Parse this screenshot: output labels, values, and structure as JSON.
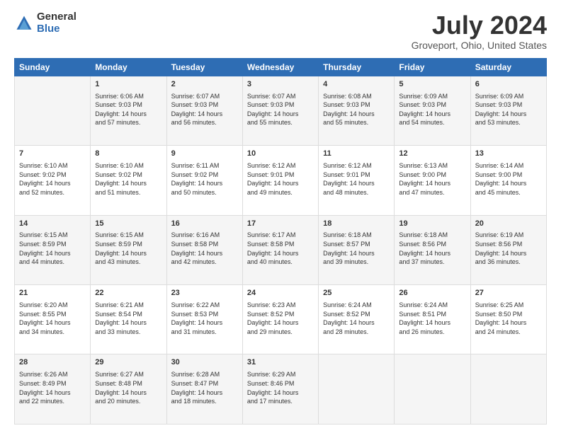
{
  "header": {
    "logo_general": "General",
    "logo_blue": "Blue",
    "title": "July 2024",
    "subtitle": "Groveport, Ohio, United States"
  },
  "days_of_week": [
    "Sunday",
    "Monday",
    "Tuesday",
    "Wednesday",
    "Thursday",
    "Friday",
    "Saturday"
  ],
  "weeks": [
    [
      {
        "day": "",
        "content": ""
      },
      {
        "day": "1",
        "content": "Sunrise: 6:06 AM\nSunset: 9:03 PM\nDaylight: 14 hours\nand 57 minutes."
      },
      {
        "day": "2",
        "content": "Sunrise: 6:07 AM\nSunset: 9:03 PM\nDaylight: 14 hours\nand 56 minutes."
      },
      {
        "day": "3",
        "content": "Sunrise: 6:07 AM\nSunset: 9:03 PM\nDaylight: 14 hours\nand 55 minutes."
      },
      {
        "day": "4",
        "content": "Sunrise: 6:08 AM\nSunset: 9:03 PM\nDaylight: 14 hours\nand 55 minutes."
      },
      {
        "day": "5",
        "content": "Sunrise: 6:09 AM\nSunset: 9:03 PM\nDaylight: 14 hours\nand 54 minutes."
      },
      {
        "day": "6",
        "content": "Sunrise: 6:09 AM\nSunset: 9:03 PM\nDaylight: 14 hours\nand 53 minutes."
      }
    ],
    [
      {
        "day": "7",
        "content": "Sunrise: 6:10 AM\nSunset: 9:02 PM\nDaylight: 14 hours\nand 52 minutes."
      },
      {
        "day": "8",
        "content": "Sunrise: 6:10 AM\nSunset: 9:02 PM\nDaylight: 14 hours\nand 51 minutes."
      },
      {
        "day": "9",
        "content": "Sunrise: 6:11 AM\nSunset: 9:02 PM\nDaylight: 14 hours\nand 50 minutes."
      },
      {
        "day": "10",
        "content": "Sunrise: 6:12 AM\nSunset: 9:01 PM\nDaylight: 14 hours\nand 49 minutes."
      },
      {
        "day": "11",
        "content": "Sunrise: 6:12 AM\nSunset: 9:01 PM\nDaylight: 14 hours\nand 48 minutes."
      },
      {
        "day": "12",
        "content": "Sunrise: 6:13 AM\nSunset: 9:00 PM\nDaylight: 14 hours\nand 47 minutes."
      },
      {
        "day": "13",
        "content": "Sunrise: 6:14 AM\nSunset: 9:00 PM\nDaylight: 14 hours\nand 45 minutes."
      }
    ],
    [
      {
        "day": "14",
        "content": "Sunrise: 6:15 AM\nSunset: 8:59 PM\nDaylight: 14 hours\nand 44 minutes."
      },
      {
        "day": "15",
        "content": "Sunrise: 6:15 AM\nSunset: 8:59 PM\nDaylight: 14 hours\nand 43 minutes."
      },
      {
        "day": "16",
        "content": "Sunrise: 6:16 AM\nSunset: 8:58 PM\nDaylight: 14 hours\nand 42 minutes."
      },
      {
        "day": "17",
        "content": "Sunrise: 6:17 AM\nSunset: 8:58 PM\nDaylight: 14 hours\nand 40 minutes."
      },
      {
        "day": "18",
        "content": "Sunrise: 6:18 AM\nSunset: 8:57 PM\nDaylight: 14 hours\nand 39 minutes."
      },
      {
        "day": "19",
        "content": "Sunrise: 6:18 AM\nSunset: 8:56 PM\nDaylight: 14 hours\nand 37 minutes."
      },
      {
        "day": "20",
        "content": "Sunrise: 6:19 AM\nSunset: 8:56 PM\nDaylight: 14 hours\nand 36 minutes."
      }
    ],
    [
      {
        "day": "21",
        "content": "Sunrise: 6:20 AM\nSunset: 8:55 PM\nDaylight: 14 hours\nand 34 minutes."
      },
      {
        "day": "22",
        "content": "Sunrise: 6:21 AM\nSunset: 8:54 PM\nDaylight: 14 hours\nand 33 minutes."
      },
      {
        "day": "23",
        "content": "Sunrise: 6:22 AM\nSunset: 8:53 PM\nDaylight: 14 hours\nand 31 minutes."
      },
      {
        "day": "24",
        "content": "Sunrise: 6:23 AM\nSunset: 8:52 PM\nDaylight: 14 hours\nand 29 minutes."
      },
      {
        "day": "25",
        "content": "Sunrise: 6:24 AM\nSunset: 8:52 PM\nDaylight: 14 hours\nand 28 minutes."
      },
      {
        "day": "26",
        "content": "Sunrise: 6:24 AM\nSunset: 8:51 PM\nDaylight: 14 hours\nand 26 minutes."
      },
      {
        "day": "27",
        "content": "Sunrise: 6:25 AM\nSunset: 8:50 PM\nDaylight: 14 hours\nand 24 minutes."
      }
    ],
    [
      {
        "day": "28",
        "content": "Sunrise: 6:26 AM\nSunset: 8:49 PM\nDaylight: 14 hours\nand 22 minutes."
      },
      {
        "day": "29",
        "content": "Sunrise: 6:27 AM\nSunset: 8:48 PM\nDaylight: 14 hours\nand 20 minutes."
      },
      {
        "day": "30",
        "content": "Sunrise: 6:28 AM\nSunset: 8:47 PM\nDaylight: 14 hours\nand 18 minutes."
      },
      {
        "day": "31",
        "content": "Sunrise: 6:29 AM\nSunset: 8:46 PM\nDaylight: 14 hours\nand 17 minutes."
      },
      {
        "day": "",
        "content": ""
      },
      {
        "day": "",
        "content": ""
      },
      {
        "day": "",
        "content": ""
      }
    ]
  ]
}
